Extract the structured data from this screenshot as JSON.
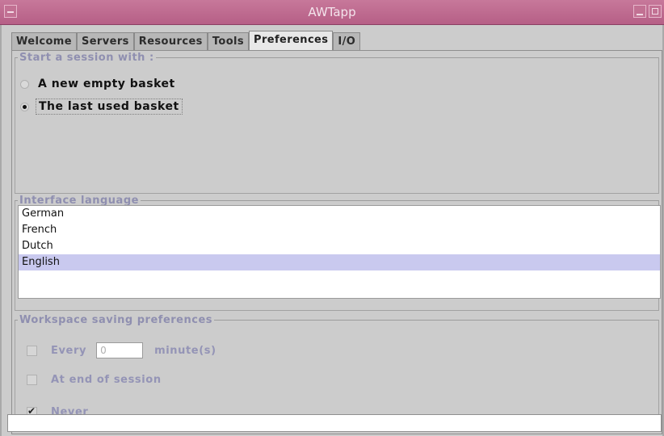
{
  "window": {
    "title": "AWTapp"
  },
  "tabs": [
    "Welcome",
    "Servers",
    "Resources",
    "Tools",
    "Preferences",
    "I/O"
  ],
  "active_tab": "Preferences",
  "session": {
    "legend": "Start a session with :",
    "options": [
      {
        "label": "A new empty basket",
        "checked": false
      },
      {
        "label": "The last used basket",
        "checked": true
      }
    ]
  },
  "language": {
    "legend": "Interface language",
    "items": [
      "German",
      "French",
      "Dutch",
      "English"
    ],
    "selected": "English"
  },
  "workspace": {
    "legend": "Workspace saving preferences",
    "every_label": "Every",
    "every_value": "0",
    "minutes_label": "minute(s)",
    "end_label": "At end of session",
    "never_label": "Never",
    "checks": {
      "every": false,
      "end": false,
      "never": true
    }
  },
  "status": {
    "text": ""
  },
  "colors": {
    "titlebar": "#b65f86",
    "selection": "#c9c9ef",
    "disabled_text": "#9494b6"
  }
}
